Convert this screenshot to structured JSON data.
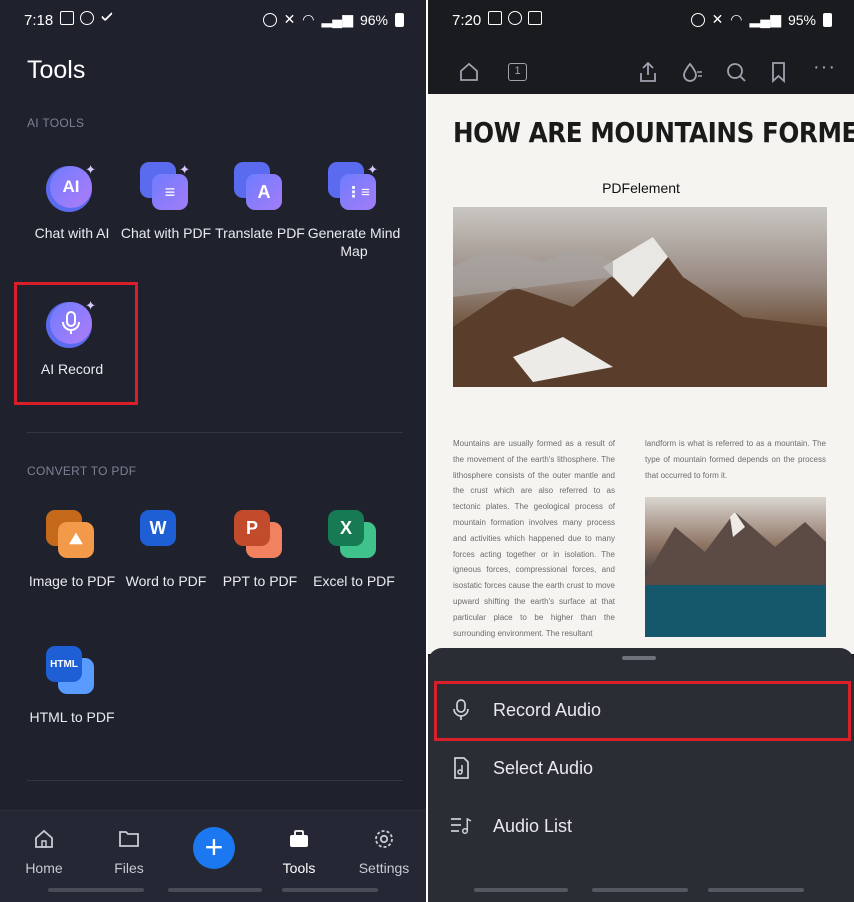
{
  "left": {
    "status": {
      "time": "7:18",
      "battery": "96%"
    },
    "title": "Tools",
    "ai_section": "AI TOOLS",
    "ai_tools": [
      {
        "label": "Chat with AI",
        "icon": "chat-ai-icon",
        "glyph": "AI"
      },
      {
        "label": "Chat with PDF",
        "icon": "chat-pdf-icon",
        "glyph": "≡"
      },
      {
        "label": "Translate PDF",
        "icon": "translate-icon",
        "glyph": "A"
      },
      {
        "label": "Generate Mind Map",
        "icon": "mind-map-icon",
        "glyph": "⋮≡"
      },
      {
        "label": "AI Record",
        "icon": "microphone-icon",
        "glyph": "🎙"
      }
    ],
    "convert_section": "CONVERT TO PDF",
    "convert_tools": [
      {
        "label": "Image to PDF",
        "icon": "image-icon",
        "glyph": "⛰",
        "back": "#c56a1a",
        "front": "#f29a4a"
      },
      {
        "label": "Word to PDF",
        "icon": "word-icon",
        "glyph": "W",
        "back": "#1e5fd6",
        "front": "#5a9bff"
      },
      {
        "label": "PPT to PDF",
        "icon": "ppt-icon",
        "glyph": "P",
        "back": "#c24b2c",
        "front": "#f2825f"
      },
      {
        "label": "Excel to PDF",
        "icon": "excel-icon",
        "glyph": "X",
        "back": "#167a52",
        "front": "#3fc28c"
      },
      {
        "label": "HTML to PDF",
        "icon": "html-icon",
        "glyph": "HTML",
        "back": "#1e5fd6",
        "front": "#5a9bff"
      }
    ],
    "nav": {
      "home": "Home",
      "files": "Files",
      "tools": "Tools",
      "settings": "Settings"
    }
  },
  "right": {
    "status": {
      "time": "7:20",
      "battery": "95%"
    },
    "page_number": "1",
    "doc": {
      "title": "HOW ARE MOUNTAINS FORMED?",
      "brand": "PDFelement",
      "col1": "Mountains are usually formed as a result of the movement of the earth's lithosphere. The lithosphere consists of the outer mantle and the crust which are also referred to as tectonic plates. The geological process of mountain formation involves many process and activities which happened due to many forces acting together or in isolation. The igneous forces, compressional forces, and isostatic forces cause the earth crust to move upward shifting the earth's surface at that particular place to be higher than the surrounding environment. The resultant",
      "col2": "landform is what is referred to as a mountain. The type of mountain formed depends on the process that occurred to form it."
    },
    "sheet": {
      "record": "Record Audio",
      "select": "Select Audio",
      "list": "Audio List"
    }
  },
  "colors": {
    "highlight": "#d81f2a",
    "accent": "#1c78f0"
  }
}
